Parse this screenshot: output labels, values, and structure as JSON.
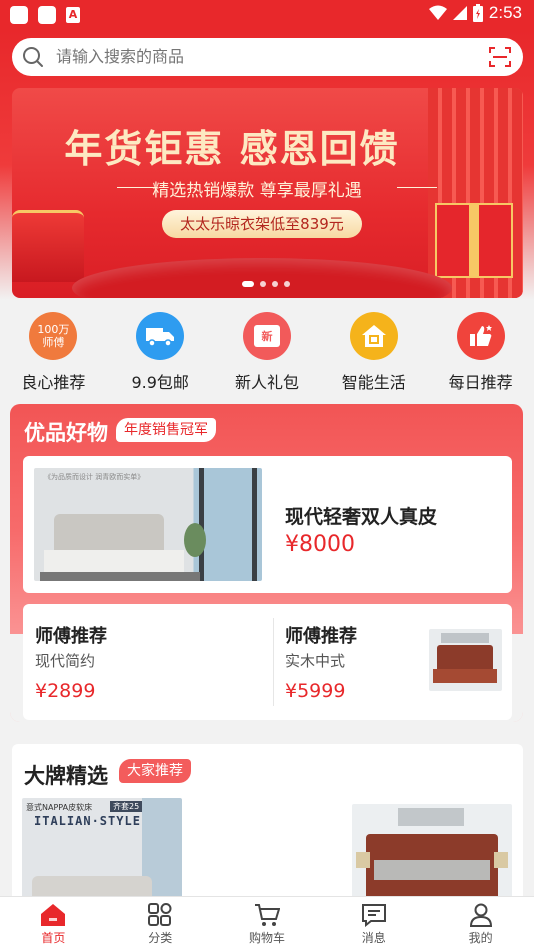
{
  "status_bar": {
    "time": "2:53"
  },
  "search": {
    "placeholder": "请输入搜索的商品"
  },
  "banner": {
    "title": "年货钜惠 感恩回馈",
    "subtitle": "精选热销爆款 尊享最厚礼遇",
    "promo": "太太乐晾衣架低至839元",
    "slides": 4,
    "active_slide": 1
  },
  "quick_nav": [
    {
      "label": "良心推荐",
      "icon_text": "100万\n师傅",
      "icon": "master-badge-icon",
      "color": "#f07a3d"
    },
    {
      "label": "9.9包邮",
      "icon": "truck-icon",
      "color": "#2e9cf0"
    },
    {
      "label": "新人礼包",
      "icon_text": "新",
      "icon": "gift-icon",
      "color": "#f25a5a"
    },
    {
      "label": "智能生活",
      "icon": "smart-home-icon",
      "color": "#f5b31b"
    },
    {
      "label": "每日推荐",
      "icon": "thumbs-up-icon",
      "color": "#f0443c"
    }
  ],
  "youpin": {
    "title": "优品好物",
    "badge": "年度销售冠军",
    "feature": {
      "image_caption": "《为品质而设计 润青欧而实单》",
      "title": "现代轻奢双人真皮",
      "price": "¥8000"
    },
    "recommend": [
      {
        "title": "师傅推荐",
        "subtitle": "现代简约",
        "price": "¥2899"
      },
      {
        "title": "师傅推荐",
        "subtitle": "实木中式",
        "price": "¥5999"
      }
    ]
  },
  "brand": {
    "title": "大牌精选",
    "badge": "大家推荐",
    "image_caption_top": "意式NAPPA皮软床",
    "image_caption_tag": "齐套25",
    "image_caption_style": "ITALIAN·STYLE"
  },
  "tabs": [
    {
      "label": "首页",
      "icon": "home-icon",
      "active": true
    },
    {
      "label": "分类",
      "icon": "category-grid-icon",
      "active": false
    },
    {
      "label": "购物车",
      "icon": "cart-icon",
      "active": false
    },
    {
      "label": "消息",
      "icon": "message-icon",
      "active": false
    },
    {
      "label": "我的",
      "icon": "profile-icon",
      "active": false
    }
  ],
  "colors": {
    "accent": "#e8282b",
    "price": "#e8282b"
  }
}
